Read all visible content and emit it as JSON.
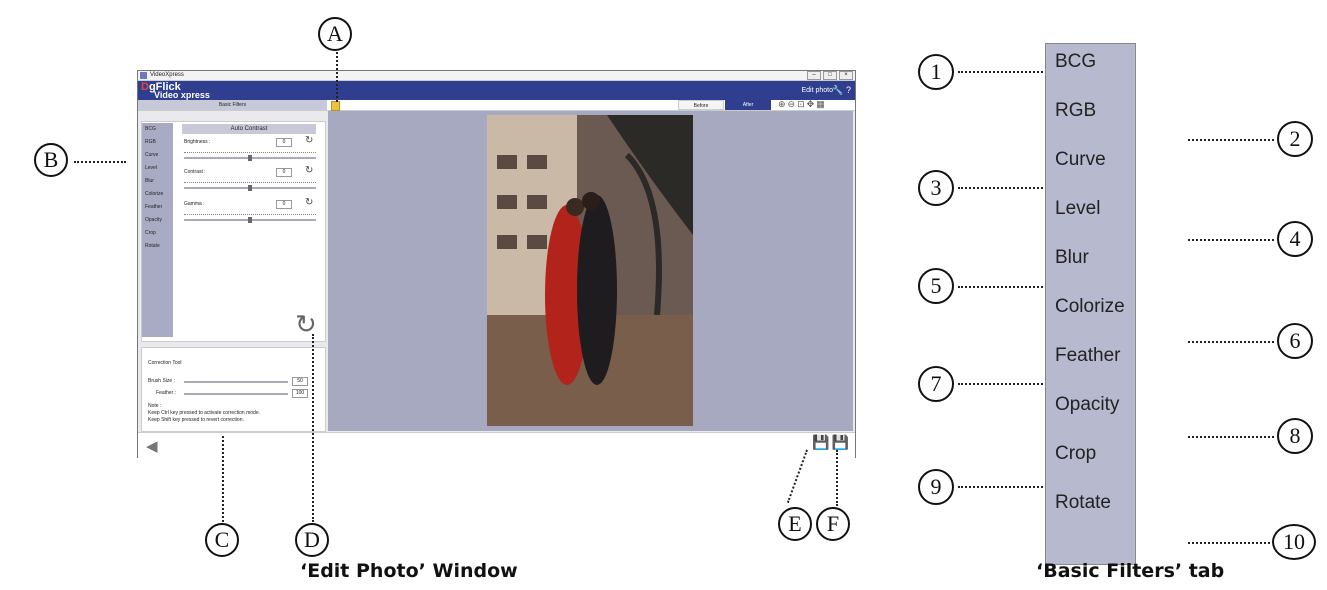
{
  "window": {
    "title": "VideoXpress",
    "logo_line1": "gFlick",
    "logo_prefix": "D",
    "logo_line2": "Video xpress",
    "header_title": "Edit photo",
    "help_label": "?",
    "tab_basic_filters": "Basic Filters",
    "before_label": "Before",
    "after_label": "After",
    "filters": [
      "BCG",
      "RGB",
      "Curve",
      "Level",
      "Blur",
      "Colorize",
      "Feather",
      "Opacity",
      "Crop",
      "Rotate"
    ],
    "auto_contrast_label": "Auto Contrast",
    "controls": [
      {
        "label": "Brightness :",
        "value": "0"
      },
      {
        "label": "Contrast :",
        "value": "0"
      },
      {
        "label": "Gamma :",
        "value": "0"
      }
    ],
    "correction": {
      "title": "Correction Tool",
      "brush_label": "Brush Size :",
      "brush_value": "50",
      "feather_label": "Feather :",
      "feather_value": "100",
      "note_title": "Note :",
      "note_line1": "Keep Ctrl key pressed to activate correction mode.",
      "note_line2": "Keep Shift key pressed to revert correction."
    }
  },
  "callouts_letters": [
    "A",
    "B",
    "C",
    "D",
    "E",
    "F"
  ],
  "callouts_numbers": [
    "1",
    "2",
    "3",
    "4",
    "5",
    "6",
    "7",
    "8",
    "9",
    "10"
  ],
  "basic_filters_tab": [
    "BCG",
    "RGB",
    "Curve",
    "Level",
    "Blur",
    "Colorize",
    "Feather",
    "Opacity",
    "Crop",
    "Rotate"
  ],
  "captions": {
    "edit_window": "‘Edit Photo’ Window",
    "basic_filters": "‘Basic Filters’ tab"
  }
}
